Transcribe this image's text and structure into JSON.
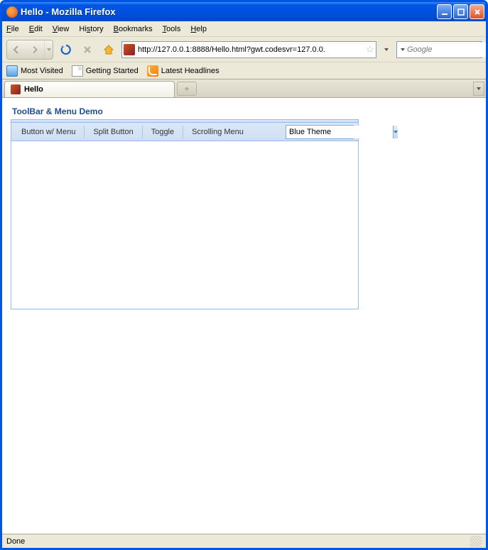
{
  "window": {
    "title": "Hello - Mozilla Firefox"
  },
  "menubar": {
    "file": "File",
    "edit": "Edit",
    "view": "View",
    "history": "History",
    "bookmarks": "Bookmarks",
    "tools": "Tools",
    "help": "Help"
  },
  "navbar": {
    "url": "http://127.0.0.1:8888/Hello.html?gwt.codesvr=127.0.0.",
    "search_placeholder": "Google"
  },
  "bookmarks_bar": {
    "most_visited": "Most Visited",
    "getting_started": "Getting Started",
    "latest_headlines": "Latest Headlines"
  },
  "tabs": {
    "active": "Hello",
    "newtab_symbol": "+"
  },
  "page": {
    "panel_title": "ToolBar & Menu Demo",
    "toolbar": {
      "button_menu": "Button w/ Menu",
      "split_button": "Split Button",
      "toggle": "Toggle",
      "scrolling_menu": "Scrolling Menu",
      "theme_value": "Blue Theme"
    }
  },
  "status": {
    "text": "Done"
  }
}
